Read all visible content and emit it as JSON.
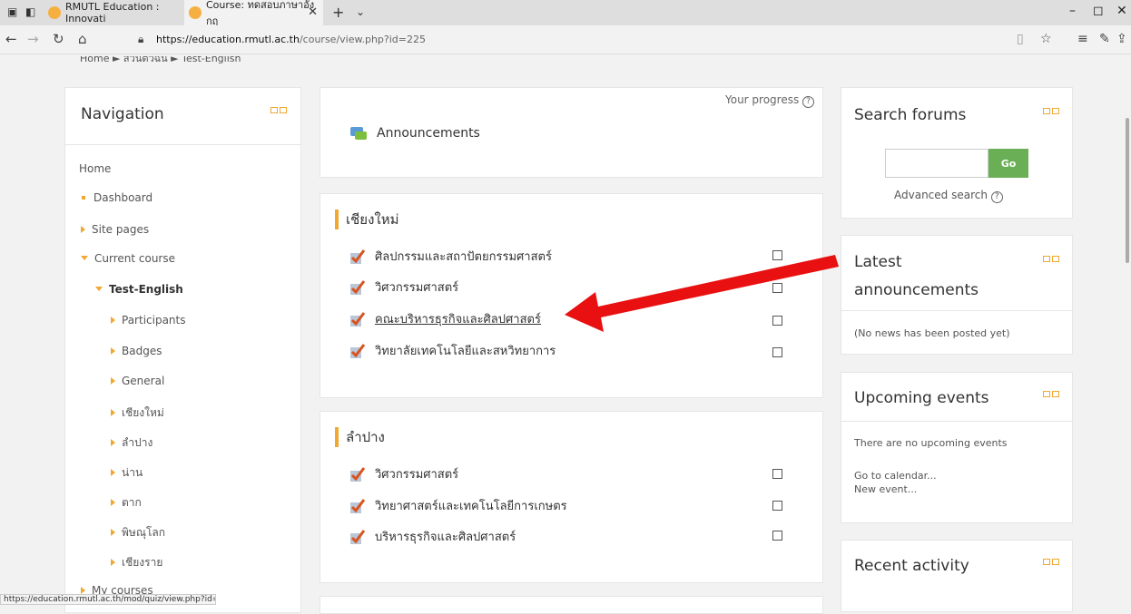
{
  "browser": {
    "tabs": [
      {
        "label": "RMUTL Education : Innovati",
        "active": false
      },
      {
        "label": "Course: ทดสอบภาษาอังกฤ",
        "active": true
      }
    ],
    "url_host": "https://education.rmutl.ac.th",
    "url_path": "/course/view.php?id=225",
    "new_tab_symbol": "+",
    "status_url": "https://education.rmutl.ac.th/mod/quiz/view.php?id=3157"
  },
  "breadcrumb": {
    "text": "Home ► ส่วนตัวฉัน ► Test-English"
  },
  "navigation": {
    "title": "Navigation",
    "home": "Home",
    "dashboard": "Dashboard",
    "site_pages": "Site pages",
    "current_course": "Current course",
    "course": "Test-English",
    "items": [
      "Participants",
      "Badges",
      "General",
      "เชียงใหม่",
      "ลำปาง",
      "น่าน",
      "ตาก",
      "พิษณุโลก",
      "เชียงราย"
    ],
    "my_courses": "My courses"
  },
  "main": {
    "progress_label": "Your progress",
    "announcements": "Announcements",
    "sections": [
      {
        "title": "เชียงใหม่",
        "activities": [
          "ศิลปกรรมและสถาปัตยกรรมศาสตร์",
          "วิศวกรรมศาสตร์",
          "คณะบริหารธุรกิจและศิลปศาสตร์",
          "วิทยาลัยเทคโนโลยีและสหวิทยาการ"
        ]
      },
      {
        "title": "ลำปาง",
        "activities": [
          "วิศวกรรมศาสตร์",
          "วิทยาศาสตร์และเทคโนโลยีการเกษตร",
          "บริหารธุรกิจและศิลปศาสตร์"
        ]
      }
    ]
  },
  "right": {
    "search_forums": {
      "title": "Search forums",
      "go": "Go",
      "advanced": "Advanced search"
    },
    "latest": {
      "title_line1": "Latest",
      "title_line2": "announcements",
      "empty": "(No news has been posted yet)"
    },
    "upcoming": {
      "title": "Upcoming events",
      "empty": "There are no upcoming events",
      "calendar": "Go to calendar...",
      "new_event": "New event..."
    },
    "recent": {
      "title": "Recent activity"
    }
  },
  "colors": {
    "accent": "#f0a830",
    "go_button": "#6aaf56",
    "arrow": "#e81010"
  }
}
